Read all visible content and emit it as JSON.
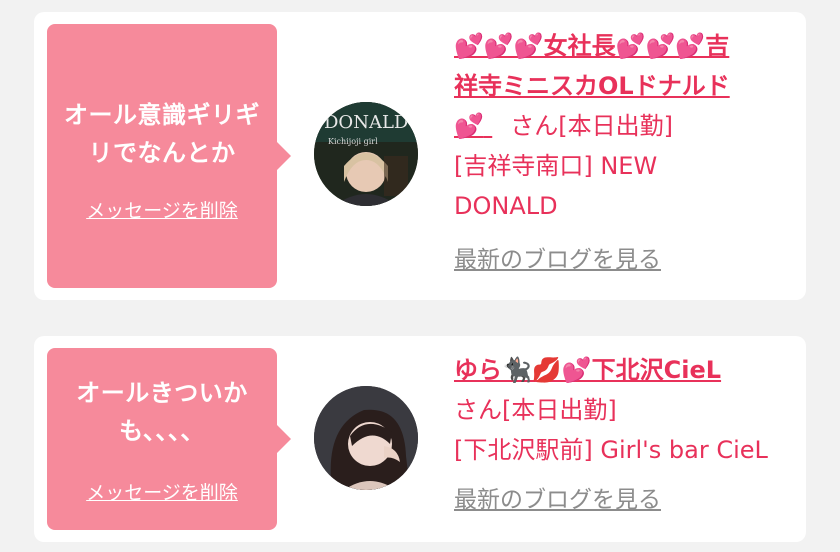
{
  "items": [
    {
      "message": "オール意識ギリギリでなんとか",
      "delete_label": "メッセージを削除",
      "name_line1": "💕💕💕女社長💕💕💕吉",
      "name_line2": "祥寺ミニスカOLドナルド",
      "name_line3": "💕",
      "honorific": "さん[本日出勤]",
      "shop": "[吉祥寺南口] NEW DONALD",
      "blog_link": "最新のブログを見る",
      "avatar_text": "DONALD",
      "avatar_subtext": "Kichijoji girl"
    },
    {
      "message": "オールきついかも、、、、",
      "delete_label": "メッセージを削除",
      "name": "ゆら🐈‍⬛💋💕下北沢CieL",
      "honorific": "さん[本日出勤]",
      "shop": "[下北沢駅前] Girl's bar CieL",
      "blog_link": "最新のブログを見る"
    }
  ],
  "colors": {
    "bubble": "#f68a9b",
    "accent": "#e8315a",
    "muted": "#8c8c8c",
    "background": "#f2f2f2"
  }
}
